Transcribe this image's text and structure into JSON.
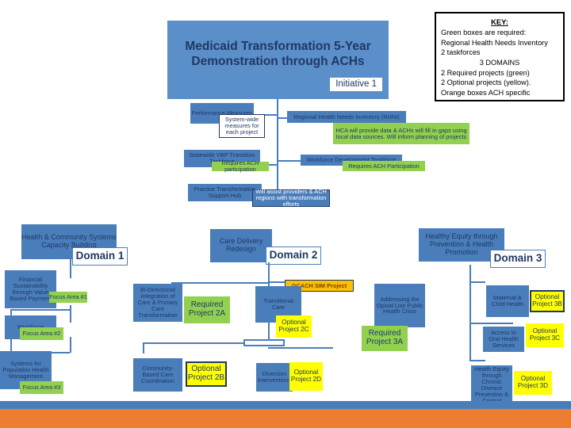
{
  "title": {
    "heading_line1": "Medicaid Transformation 5-Year",
    "heading_line2": "Demonstration through ACHs",
    "initiative_badge": "Initiative 1"
  },
  "key": {
    "title": "KEY:",
    "lines": [
      "Green boxes are required:",
      "Regional Health Needs Inventory",
      "2 taskforces",
      "3 DOMAINS",
      "2 Required projects (green)",
      "2 Optional projects (yellow).",
      "Orange boxes ACH specific"
    ]
  },
  "top_section": {
    "performance_measures": "Performance Measures",
    "performance_callout": "System-wide measures for each project",
    "rhni": "Regional Health Needs Inventory (RHNI)",
    "rhni_note": "HCA will provide data & ACHs will fill in gaps using local data sources. Will inform planning of projects",
    "vbp_taskforce": "Statewide VBP Transition Taskforce",
    "vbp_note": "Requires ACH participation",
    "workforce_taskforce": "Workforce Development Taskforce",
    "workforce_note": "Requires ACH Participation",
    "practice_hub": "Practice Transformation Support Hub",
    "practice_note": "Will assist providers & ACH regions with transformation efforts"
  },
  "domains": [
    {
      "id": "domain-1",
      "label": "Domain 1",
      "name": "Health & Community Systems Capacity Building"
    },
    {
      "id": "domain-2",
      "label": "Domain 2",
      "name": "Care Delivery Redesign"
    },
    {
      "id": "domain-3",
      "label": "Domain 3",
      "name": "Healthy Equity through Prevention & Health Promotion"
    }
  ],
  "domain1_items": [
    {
      "title": "Financial Sustainability through Value Based Payment",
      "tag": "Focus Area #1"
    },
    {
      "title": "Workforce",
      "tag": "Focus Area #2"
    },
    {
      "title": "Systems for Population Health Management",
      "tag": "Focus Area #3"
    }
  ],
  "domain2_items": [
    {
      "title": "Bi-Directional Integration of Care & Primary Care Transformation",
      "tag": "Required Project 2A",
      "tag_type": "required"
    },
    {
      "title": "Transitional Care",
      "tag": "Optional Project 2C",
      "tag_type": "optional"
    },
    {
      "title": "Community-Based Care Coordination",
      "tag": "Optional Project 2B",
      "tag_type": "optional"
    },
    {
      "title": "Diversion Interventions",
      "tag": "Optional Project 2D",
      "tag_type": "optional"
    }
  ],
  "domain2_extra": {
    "label": "GCACH SIM Project"
  },
  "domain3_items": [
    {
      "title": "Addressing the Opioid Use Public Health Crisis",
      "tag": "Required Project 3A",
      "tag_type": "required"
    },
    {
      "title": "Maternal & Child Health",
      "tag": "Optional Project 3B",
      "tag_type": "optional"
    },
    {
      "title": "Access to Oral Health Services",
      "tag": "Optional Project 3C",
      "tag_type": "optional"
    },
    {
      "title": "Health Equity through Chronic Disease Prevention & Control",
      "tag": "Optional Project 3D",
      "tag_type": "optional"
    }
  ],
  "colors": {
    "blue": "#4a7ebb",
    "banner_blue": "#5b8fc9",
    "green": "#92d050",
    "yellow": "#ffff00",
    "orange_tag": "#ffc000",
    "orange_bar": "#ed7d31",
    "dark_text": "#1f3864"
  }
}
